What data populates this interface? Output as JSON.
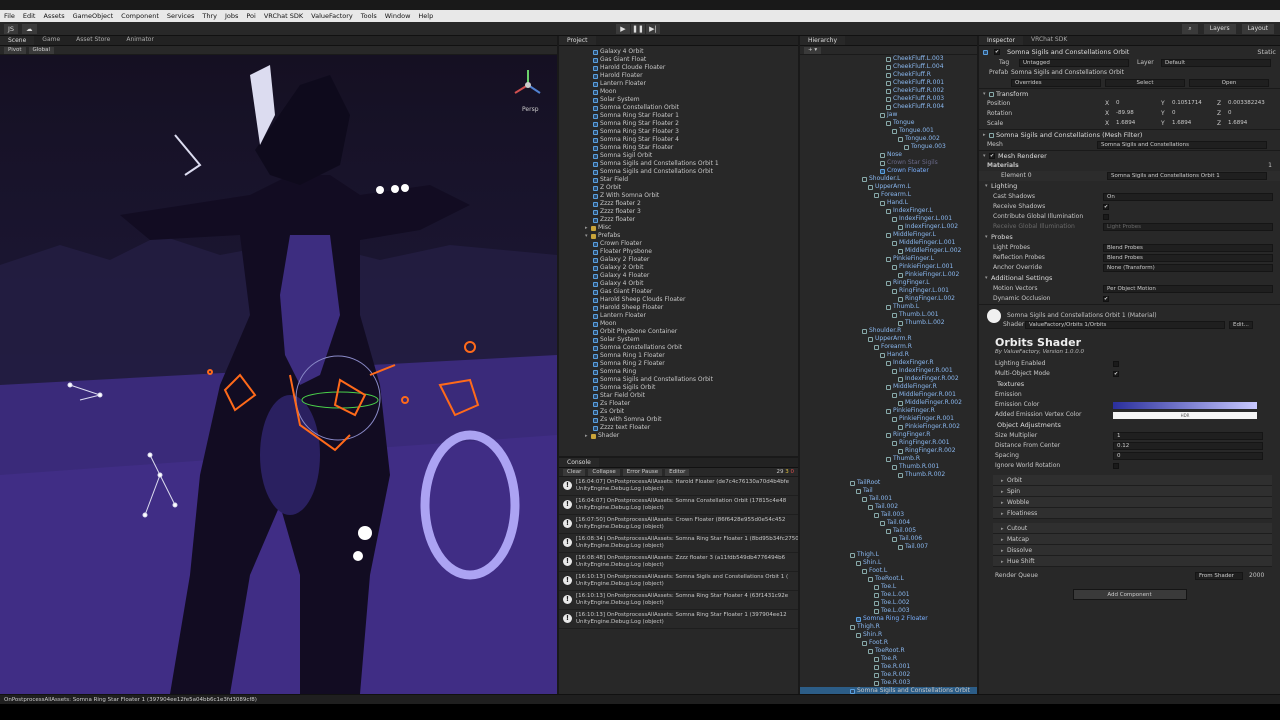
{
  "menu": [
    "File",
    "Edit",
    "Assets",
    "GameObject",
    "Component",
    "Services",
    "Thry",
    "Jobs",
    "Poi",
    "VRChat SDK",
    "ValueFactory",
    "Tools",
    "Window",
    "Help"
  ],
  "toolbar": {
    "account": "JS",
    "play_icon": "▶",
    "pause_icon": "❚❚",
    "step_icon": "▶|",
    "layers": "Layers",
    "layout": "Layout"
  },
  "scene": {
    "tabs": [
      "Scene",
      "Game",
      "Asset Store",
      "Animator"
    ],
    "pivot": "Pivot",
    "global": "Global",
    "persp": "Persp"
  },
  "project": {
    "tab": "Project",
    "items": [
      {
        "d": 3,
        "t": "Galaxy 4 Orbit"
      },
      {
        "d": 3,
        "t": "Gas Giant Float"
      },
      {
        "d": 3,
        "t": "Harold Cloude Floater"
      },
      {
        "d": 3,
        "t": "Harold Floater"
      },
      {
        "d": 3,
        "t": "Lantern Floater"
      },
      {
        "d": 3,
        "t": "Moon"
      },
      {
        "d": 3,
        "t": "Solar System"
      },
      {
        "d": 3,
        "t": "Somna Constellation Orbit"
      },
      {
        "d": 3,
        "t": "Somna Ring Star Floater 1"
      },
      {
        "d": 3,
        "t": "Somna Ring Star Floater 2"
      },
      {
        "d": 3,
        "t": "Somna Ring Star Floater 3"
      },
      {
        "d": 3,
        "t": "Somna Ring Star Floater 4"
      },
      {
        "d": 3,
        "t": "Somna Ring Star Floater"
      },
      {
        "d": 3,
        "t": "Somna Sigil Orbit"
      },
      {
        "d": 3,
        "t": "Somna Sigils and Constellations Orbit 1"
      },
      {
        "d": 3,
        "t": "Somna Sigils and Constellations Orbit"
      },
      {
        "d": 3,
        "t": "Star Field"
      },
      {
        "d": 3,
        "t": "Z Orbit"
      },
      {
        "d": 3,
        "t": "Z With Somna Orbit"
      },
      {
        "d": 3,
        "t": "Zzzz floater 2"
      },
      {
        "d": 3,
        "t": "Zzzz floater 3"
      },
      {
        "d": 3,
        "t": "Zzzz floater"
      },
      {
        "d": 2,
        "t": "Misc",
        "f": 1
      },
      {
        "d": 2,
        "t": "Prefabs",
        "f": 1
      },
      {
        "d": 3,
        "t": "Crown Floater"
      },
      {
        "d": 3,
        "t": "Floater Physbone"
      },
      {
        "d": 3,
        "t": "Galaxy 2 Floater"
      },
      {
        "d": 3,
        "t": "Galaxy 2 Orbit"
      },
      {
        "d": 3,
        "t": "Galaxy 4 Floater"
      },
      {
        "d": 3,
        "t": "Galaxy 4 Orbit"
      },
      {
        "d": 3,
        "t": "Gas Giant Floater"
      },
      {
        "d": 3,
        "t": "Harold Sheep Clouds Floater"
      },
      {
        "d": 3,
        "t": "Harold Sheep Floater"
      },
      {
        "d": 3,
        "t": "Lantern Floater"
      },
      {
        "d": 3,
        "t": "Moon"
      },
      {
        "d": 3,
        "t": "Orbit Physbone Container"
      },
      {
        "d": 3,
        "t": "Solar System"
      },
      {
        "d": 3,
        "t": "Somna Constellations Orbit"
      },
      {
        "d": 3,
        "t": "Somna Ring 1 Floater"
      },
      {
        "d": 3,
        "t": "Somna Ring 2 Floater"
      },
      {
        "d": 3,
        "t": "Somna Ring"
      },
      {
        "d": 3,
        "t": "Somna Sigils and Constellations Orbit"
      },
      {
        "d": 3,
        "t": "Somna Sigils Orbit"
      },
      {
        "d": 3,
        "t": "Star Field Orbit"
      },
      {
        "d": 3,
        "t": "Zs Floater"
      },
      {
        "d": 3,
        "t": "Zs Orbit"
      },
      {
        "d": 3,
        "t": "Zs with Somna Orbit"
      },
      {
        "d": 3,
        "t": "Zzzz text Floater"
      },
      {
        "d": 2,
        "t": "Shader",
        "f": 1
      }
    ]
  },
  "console": {
    "tab": "Console",
    "clear": "Clear",
    "collapse": "Collapse",
    "error_pause": "Error Pause",
    "editor": "Editor",
    "warn_count": "29",
    "err_count": "3",
    "info_count": "0",
    "lines": [
      [
        "[16:04:07] OnPostprocessAllAssets: Harold Floater (de7c4c76130a70d4b4bfe",
        "UnityEngine.Debug:Log (object)"
      ],
      [
        "[16:04:07] OnPostprocessAllAssets: Somna Constellation Orbit (17815c4e48",
        "UnityEngine.Debug:Log (object)"
      ],
      [
        "[16:07:50] OnPostprocessAllAssets: Crown Floater (86f6428e955d0e54c452",
        "UnityEngine.Debug:Log (object)"
      ],
      [
        "[16:08:34] OnPostprocessAllAssets: Somna Ring Star Floater 1 (8bd95b34fc27505474",
        "UnityEngine.Debug:Log (object)"
      ],
      [
        "[16:08:48] OnPostprocessAllAssets: Zzzz floater 3 (a11fdb549db4776494b6",
        "UnityEngine.Debug:Log (object)"
      ],
      [
        "[16:10:13] OnPostprocessAllAssets: Somna Sigils and Constellations Orbit 1 (",
        "UnityEngine.Debug:Log (object)"
      ],
      [
        "[16:10:13] OnPostprocessAllAssets: Somna Ring Star Floater 4 (63f1431c92e",
        "UnityEngine.Debug:Log (object)"
      ],
      [
        "[16:10:13] OnPostprocessAllAssets: Somna Ring Star Floater 1 (397904ee12",
        "UnityEngine.Debug:Log (object)"
      ]
    ]
  },
  "hierarchy": {
    "tab": "Hierarchy",
    "items": [
      {
        "d": 7,
        "t": "CheekFluff.L.003"
      },
      {
        "d": 7,
        "t": "CheekFluff.L.004"
      },
      {
        "d": 7,
        "t": "CheekFluff.R"
      },
      {
        "d": 7,
        "t": "CheekFluff.R.001"
      },
      {
        "d": 7,
        "t": "CheekFluff.R.002"
      },
      {
        "d": 7,
        "t": "CheekFluff.R.003"
      },
      {
        "d": 7,
        "t": "CheekFluff.R.004"
      },
      {
        "d": 6,
        "t": "Jaw"
      },
      {
        "d": 7,
        "t": "Tongue"
      },
      {
        "d": 8,
        "t": "Tongue.001"
      },
      {
        "d": 9,
        "t": "Tongue.002"
      },
      {
        "d": 10,
        "t": "Tongue.003"
      },
      {
        "d": 6,
        "t": "Nose"
      },
      {
        "d": 6,
        "t": "Crown Star Sigils",
        "dim": 1
      },
      {
        "d": 6,
        "t": "Crown Floater",
        "blue": 1
      },
      {
        "d": 3,
        "t": "Shoulder.L"
      },
      {
        "d": 4,
        "t": "UpperArm.L"
      },
      {
        "d": 5,
        "t": "Forearm.L"
      },
      {
        "d": 6,
        "t": "Hand.L"
      },
      {
        "d": 7,
        "t": "IndexFinger.L"
      },
      {
        "d": 8,
        "t": "IndexFinger.L.001"
      },
      {
        "d": 9,
        "t": "IndexFinger.L.002"
      },
      {
        "d": 7,
        "t": "MiddleFinger.L"
      },
      {
        "d": 8,
        "t": "MiddleFinger.L.001"
      },
      {
        "d": 9,
        "t": "MiddleFinger.L.002"
      },
      {
        "d": 7,
        "t": "PinkieFinger.L"
      },
      {
        "d": 8,
        "t": "PinkieFinger.L.001"
      },
      {
        "d": 9,
        "t": "PinkieFinger.L.002"
      },
      {
        "d": 7,
        "t": "RingFinger.L"
      },
      {
        "d": 8,
        "t": "RingFinger.L.001"
      },
      {
        "d": 9,
        "t": "RingFinger.L.002"
      },
      {
        "d": 7,
        "t": "Thumb.L"
      },
      {
        "d": 8,
        "t": "Thumb.L.001"
      },
      {
        "d": 9,
        "t": "Thumb.L.002"
      },
      {
        "d": 3,
        "t": "Shoulder.R"
      },
      {
        "d": 4,
        "t": "UpperArm.R"
      },
      {
        "d": 5,
        "t": "Forearm.R"
      },
      {
        "d": 6,
        "t": "Hand.R"
      },
      {
        "d": 7,
        "t": "IndexFinger.R"
      },
      {
        "d": 8,
        "t": "IndexFinger.R.001"
      },
      {
        "d": 9,
        "t": "IndexFinger.R.002"
      },
      {
        "d": 7,
        "t": "MiddleFinger.R"
      },
      {
        "d": 8,
        "t": "MiddleFinger.R.001"
      },
      {
        "d": 9,
        "t": "MiddleFinger.R.002"
      },
      {
        "d": 7,
        "t": "PinkieFinger.R"
      },
      {
        "d": 8,
        "t": "PinkieFinger.R.001"
      },
      {
        "d": 9,
        "t": "PinkieFinger.R.002"
      },
      {
        "d": 7,
        "t": "RingFinger.R"
      },
      {
        "d": 8,
        "t": "RingFinger.R.001"
      },
      {
        "d": 9,
        "t": "RingFinger.R.002"
      },
      {
        "d": 7,
        "t": "Thumb.R"
      },
      {
        "d": 8,
        "t": "Thumb.R.001"
      },
      {
        "d": 9,
        "t": "Thumb.R.002"
      },
      {
        "d": 1,
        "t": "TailRoot"
      },
      {
        "d": 2,
        "t": "Tail"
      },
      {
        "d": 3,
        "t": "Tail.001"
      },
      {
        "d": 4,
        "t": "Tail.002"
      },
      {
        "d": 5,
        "t": "Tail.003"
      },
      {
        "d": 6,
        "t": "Tail.004"
      },
      {
        "d": 7,
        "t": "Tail.005"
      },
      {
        "d": 8,
        "t": "Tail.006"
      },
      {
        "d": 9,
        "t": "Tail.007"
      },
      {
        "d": 1,
        "t": "Thigh.L"
      },
      {
        "d": 2,
        "t": "Shin.L"
      },
      {
        "d": 3,
        "t": "Foot.L"
      },
      {
        "d": 4,
        "t": "ToeRoot.L"
      },
      {
        "d": 5,
        "t": "Toe.L"
      },
      {
        "d": 5,
        "t": "Toe.L.001"
      },
      {
        "d": 5,
        "t": "Toe.L.002"
      },
      {
        "d": 5,
        "t": "Toe.L.003"
      },
      {
        "d": 2,
        "t": "Somna Ring 2 Floater",
        "blue": 1
      },
      {
        "d": 1,
        "t": "Thigh.R"
      },
      {
        "d": 2,
        "t": "Shin.R"
      },
      {
        "d": 3,
        "t": "Foot.R"
      },
      {
        "d": 4,
        "t": "ToeRoot.R"
      },
      {
        "d": 5,
        "t": "Toe.R"
      },
      {
        "d": 5,
        "t": "Toe.R.001"
      },
      {
        "d": 5,
        "t": "Toe.R.002"
      },
      {
        "d": 5,
        "t": "Toe.R.003"
      },
      {
        "d": 0,
        "t": "Somna Sigils and Constellations Orbit",
        "sel": 1
      }
    ]
  },
  "inspector": {
    "tabs": [
      "Inspector",
      "VRChat SDK"
    ],
    "object_name": "Somna Sigils and Constellations Orbit",
    "static": "Static",
    "tag_label": "Tag",
    "tag": "Untagged",
    "layer_label": "Layer",
    "layer": "Default",
    "prefab_label": "Prefab",
    "prefab": "Somna Sigils and Constellations Orbit",
    "overrides": "Overrides",
    "select": "Select",
    "open": "Open",
    "transform": {
      "title": "Transform",
      "position": [
        "0",
        "0.1051714",
        "0.003382243"
      ],
      "rotation": [
        "-89.98",
        "0",
        "0"
      ],
      "scale": [
        "1.6894",
        "1.6894",
        "1.6894"
      ],
      "labels": [
        "Position",
        "Rotation",
        "Scale"
      ],
      "axes": [
        "X",
        "Y",
        "Z"
      ]
    },
    "mesh_filter": {
      "title": "Somna Sigils and Constellations (Mesh Filter)",
      "label": "Mesh",
      "value": "Somna Sigils and Constellations"
    },
    "mesh_renderer": {
      "title": "Mesh Renderer",
      "materials": "Materials",
      "materials_count": "1",
      "element0_label": "Element 0",
      "element0": "Somna Sigils and Constellations Orbit 1"
    },
    "lighting": {
      "title": "Lighting",
      "rows": [
        [
          "Cast Shadows",
          "On"
        ],
        [
          "Receive Shadows",
          "✔"
        ],
        [
          "Contribute Global Illumination",
          ""
        ],
        [
          "Receive Global Illumination",
          "Light Probes"
        ]
      ]
    },
    "probes": {
      "title": "Probes",
      "rows": [
        [
          "Light Probes",
          "Blend Probes"
        ],
        [
          "Reflection Probes",
          "Blend Probes"
        ],
        [
          "Anchor Override",
          "None (Transform)"
        ]
      ]
    },
    "additional": {
      "title": "Additional Settings",
      "rows": [
        [
          "Motion Vectors",
          "Per Object Motion"
        ],
        [
          "Dynamic Occlusion",
          "✔"
        ]
      ]
    },
    "material": {
      "name": "Somna Sigils and Constellations Orbit 1 (Material)",
      "shader_label": "Shader",
      "shader": "ValueFactory/Orbits 1/Orbits",
      "edit": "Edit..."
    },
    "orbits": {
      "title": "Orbits Shader",
      "byline": "By ValueFactory, Version 1.0.0.0",
      "lighting_enabled": "Lighting Enabled",
      "multi_object": "Multi-Object Mode",
      "textures": "Textures",
      "emission": "Emission",
      "emission_color": "Emission Color",
      "added_emission": "Added Emission Vertex Color",
      "hdr": "HDR",
      "object_adjustments": "Object Adjustments",
      "size_mult_label": "Size Multiplier",
      "size_mult": "1",
      "distance_label": "Distance From Center",
      "distance": "0.12",
      "spacing_label": "Spacing",
      "spacing": "0",
      "ignore_rot": "Ignore World Rotation",
      "foldouts": [
        "Orbit",
        "Spin",
        "Wobble",
        "Floatiness",
        "Cutout",
        "Matcap",
        "Dissolve",
        "Hue Shift"
      ],
      "render_queue_label": "Render Queue",
      "render_queue_src": "From Shader",
      "render_queue": "2000"
    },
    "add_component": "Add Component"
  },
  "status": "OnPostprocessAllAssets: Somna Ring Star Floater 1 (397904ee12fe5a04bb6c1e3fd3089cf8)",
  "colors": {
    "emission_gradient_start": "#2a2f9c",
    "emission_gradient_end": "#c8c8ff",
    "accent": "#5a8ad8",
    "orange": "#ff6a1a",
    "purple": "#3a2a7a"
  }
}
